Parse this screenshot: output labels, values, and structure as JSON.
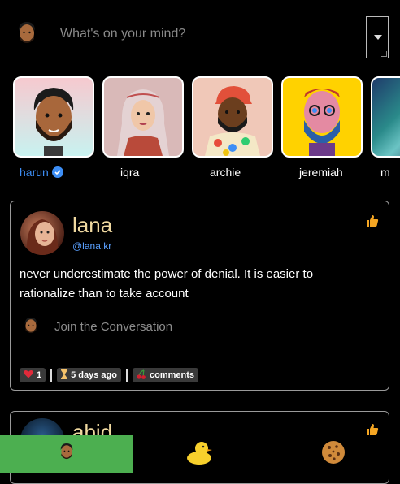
{
  "composer": {
    "placeholder": "What's on your mind?"
  },
  "stories": [
    {
      "name": "harun",
      "verified": true
    },
    {
      "name": "iqra"
    },
    {
      "name": "archie"
    },
    {
      "name": "jeremiah"
    },
    {
      "name": "m"
    }
  ],
  "post": {
    "author": "lana",
    "handle": "@lana.kr",
    "text": "never underestimate the power of denial. It is easier to rationalize than to take account",
    "join_placeholder": "Join the Conversation",
    "likes": "1",
    "time": "5 days ago",
    "comments": "comments"
  },
  "post2": {
    "author": "abid"
  },
  "nav": {
    "tabs": [
      "profile",
      "duck",
      "cookie"
    ]
  },
  "colors": {
    "accent_green": "#4caf50",
    "link_blue": "#3d8ef5",
    "like_orange": "#f5a623"
  }
}
